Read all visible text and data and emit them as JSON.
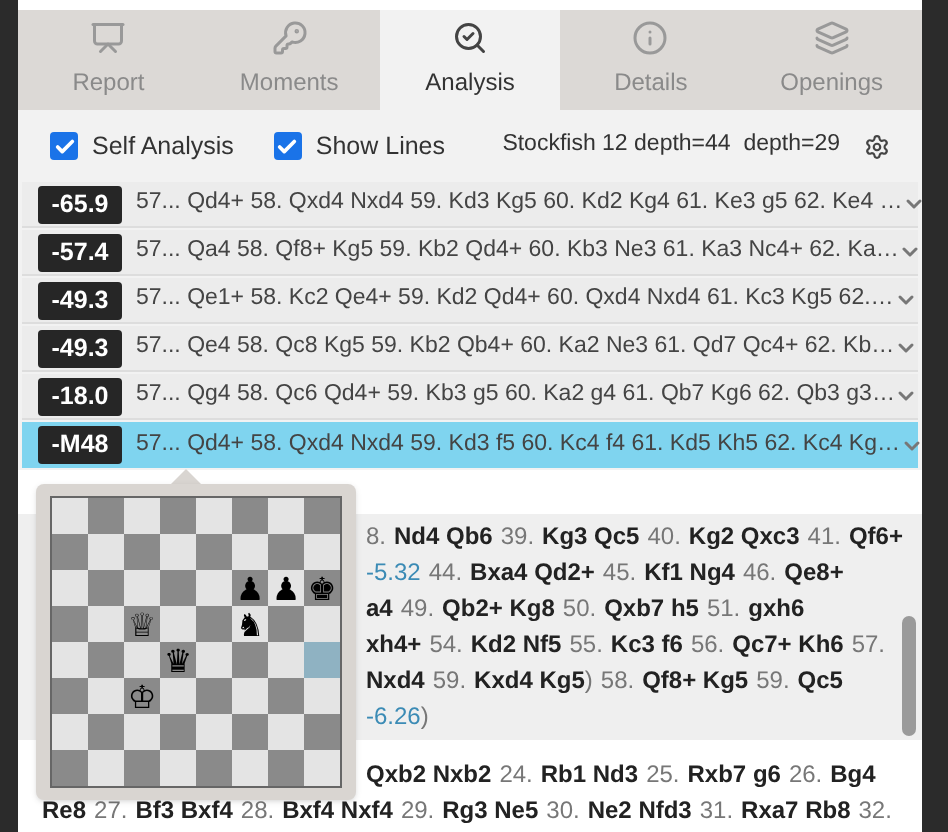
{
  "tabs": [
    {
      "label": "Report",
      "selected": false
    },
    {
      "label": "Moments",
      "selected": false
    },
    {
      "label": "Analysis",
      "selected": true
    },
    {
      "label": "Details",
      "selected": false
    },
    {
      "label": "Openings",
      "selected": false
    }
  ],
  "toolbar": {
    "options": [
      {
        "label": "Self Analysis",
        "checked": true
      },
      {
        "label": "Show Lines",
        "checked": true
      }
    ],
    "engine_info": "Stockfish 12 depth=44  depth=29"
  },
  "lines": [
    {
      "eval": "-65.9",
      "moves": "57... Qd4+ 58. Qxd4 Nxd4 59. Kd3 Kg5 60. Kd2 Kg4 61. Ke3 g5 62. Ke4 …",
      "selected": false
    },
    {
      "eval": "-57.4",
      "moves": "57... Qa4 58. Qf8+ Kg5 59. Kb2 Qd4+ 60. Kb3 Ne3 61. Ka3 Nc4+ 62. Ka…",
      "selected": false
    },
    {
      "eval": "-49.3",
      "moves": "57... Qe1+ 58. Kc2 Qe4+ 59. Kd2 Qd4+ 60. Qxd4 Nxd4 61. Kc3 Kg5 62.…",
      "selected": false
    },
    {
      "eval": "-49.3",
      "moves": "57... Qe4 58. Qc8 Kg5 59. Kb2 Qb4+ 60. Ka2 Ne3 61. Qd7 Qc4+ 62. Kb…",
      "selected": false
    },
    {
      "eval": "-18.0",
      "moves": "57... Qg4 58. Qc6 Qd4+ 59. Kb3 g5 60. Ka2 g4 61. Qb7 Kg6 62. Qb3 g3…",
      "selected": false
    },
    {
      "eval": "-M48",
      "moves": "57... Qd4+ 58. Qxd4 Nxd4 59. Kd3 f5 60. Kc4 f4 61. Kd5 Kh5 62. Kc4 Kg…",
      "selected": true
    }
  ],
  "variation": [
    [
      {
        "text": "8.",
        "kind": "number"
      },
      {
        "text": "Nd4 Qb6",
        "kind": "move"
      },
      {
        "text": "39.",
        "kind": "number"
      },
      {
        "text": "Kg3 Qc5",
        "kind": "move"
      },
      {
        "text": "40.",
        "kind": "number"
      },
      {
        "text": "Kg2 Qxc3",
        "kind": "move"
      },
      {
        "text": "41.",
        "kind": "number"
      },
      {
        "text": "Qf6+",
        "kind": "move"
      }
    ],
    [
      {
        "text": "-5.32",
        "kind": "eval"
      },
      {
        "text": "44.",
        "kind": "number"
      },
      {
        "text": "Bxa4 Qd2+",
        "kind": "move"
      },
      {
        "text": "45.",
        "kind": "number"
      },
      {
        "text": "Kf1 Ng4",
        "kind": "move"
      },
      {
        "text": "46.",
        "kind": "number"
      },
      {
        "text": "Qe8+",
        "kind": "move"
      }
    ],
    [
      {
        "text": "a4",
        "kind": "move"
      },
      {
        "text": "49.",
        "kind": "number"
      },
      {
        "text": "Qb2+ Kg8",
        "kind": "move"
      },
      {
        "text": "50.",
        "kind": "number"
      },
      {
        "text": "Qxb7 h5",
        "kind": "move"
      },
      {
        "text": "51.",
        "kind": "number"
      },
      {
        "text": "gxh6",
        "kind": "move"
      }
    ],
    [
      {
        "text": "xh4+",
        "kind": "move"
      },
      {
        "text": "54.",
        "kind": "number"
      },
      {
        "text": "Kd2 Nf5",
        "kind": "move"
      },
      {
        "text": "55.",
        "kind": "number"
      },
      {
        "text": "Kc3 f6",
        "kind": "move"
      },
      {
        "text": "56.",
        "kind": "number"
      },
      {
        "text": "Qc7+ Kh6",
        "kind": "move"
      },
      {
        "text": "57.",
        "kind": "number"
      }
    ],
    [
      {
        "text": "Nxd4",
        "kind": "move"
      },
      {
        "text": "59.",
        "kind": "number"
      },
      {
        "text": "Kxd4 Kg5",
        "kind": "move"
      },
      {
        "text": ")",
        "kind": "number"
      },
      {
        "text": "58.",
        "kind": "number"
      },
      {
        "text": "Qf8+ Kg5",
        "kind": "move"
      },
      {
        "text": "59.",
        "kind": "number"
      },
      {
        "text": "Qc5",
        "kind": "move"
      }
    ],
    [
      {
        "text": "-6.26",
        "kind": "eval"
      },
      {
        "text": ")",
        "kind": "number"
      }
    ]
  ],
  "mainline": [
    [
      {
        "text": "Qxb2 Nxb2",
        "kind": "move"
      },
      {
        "text": "24.",
        "kind": "number"
      },
      {
        "text": "Rb1 Nd3",
        "kind": "move"
      },
      {
        "text": "25.",
        "kind": "number"
      },
      {
        "text": "Rxb7 g6",
        "kind": "move"
      },
      {
        "text": "26.",
        "kind": "number"
      },
      {
        "text": "Bg4",
        "kind": "move"
      }
    ],
    [
      {
        "text": "Re8",
        "kind": "move"
      },
      {
        "text": "27.",
        "kind": "number"
      },
      {
        "text": "Bf3 Bxf4",
        "kind": "move"
      },
      {
        "text": "28.",
        "kind": "number"
      },
      {
        "text": "Bxf4 Nxf4",
        "kind": "move"
      },
      {
        "text": "29.",
        "kind": "number"
      },
      {
        "text": "Rg3 Ne5",
        "kind": "move"
      },
      {
        "text": "30.",
        "kind": "number"
      },
      {
        "text": "Ne2 Nfd3",
        "kind": "move"
      },
      {
        "text": "31.",
        "kind": "number"
      },
      {
        "text": "Rxa7 Rb8",
        "kind": "move"
      },
      {
        "text": "32.",
        "kind": "number"
      }
    ]
  ],
  "board": {
    "ranks": [
      [
        {
          "selected": false
        },
        {
          "selected": false
        },
        {
          "selected": false
        },
        {
          "selected": false
        },
        {
          "selected": false
        },
        {
          "selected": false
        },
        {
          "selected": false
        },
        {
          "selected": false
        }
      ],
      [
        {
          "selected": false
        },
        {
          "selected": false
        },
        {
          "selected": false
        },
        {
          "selected": false
        },
        {
          "selected": false
        },
        {
          "selected": false
        },
        {
          "selected": false
        },
        {
          "selected": false
        }
      ],
      [
        {
          "selected": false
        },
        {
          "selected": false
        },
        {
          "selected": false
        },
        {
          "selected": false
        },
        {
          "selected": false
        },
        {
          "glyph": "♟",
          "selected": false
        },
        {
          "glyph": "♟",
          "selected": false
        },
        {
          "glyph": "♚",
          "selected": false
        }
      ],
      [
        {
          "selected": false
        },
        {
          "selected": false
        },
        {
          "glyph": "♕",
          "selected": false
        },
        {
          "selected": false
        },
        {
          "selected": false
        },
        {
          "glyph": "♞",
          "selected": false
        },
        {
          "selected": false
        },
        {
          "selected": false
        }
      ],
      [
        {
          "selected": false
        },
        {
          "selected": false
        },
        {
          "selected": false
        },
        {
          "glyph": "♛",
          "selected": false
        },
        {
          "selected": false
        },
        {
          "selected": false
        },
        {
          "selected": false
        },
        {
          "selected": true
        }
      ],
      [
        {
          "selected": false
        },
        {
          "selected": false
        },
        {
          "glyph": "♔",
          "selected": false
        },
        {
          "selected": false
        },
        {
          "selected": false
        },
        {
          "selected": false
        },
        {
          "selected": false
        },
        {
          "selected": false
        }
      ],
      [
        {
          "selected": false
        },
        {
          "selected": false
        },
        {
          "selected": false
        },
        {
          "selected": false
        },
        {
          "selected": false
        },
        {
          "selected": false
        },
        {
          "selected": false
        },
        {
          "selected": false
        }
      ],
      [
        {
          "selected": false
        },
        {
          "selected": false
        },
        {
          "selected": false
        },
        {
          "selected": false
        },
        {
          "selected": false
        },
        {
          "selected": false
        },
        {
          "selected": false
        },
        {
          "selected": false
        }
      ]
    ]
  }
}
